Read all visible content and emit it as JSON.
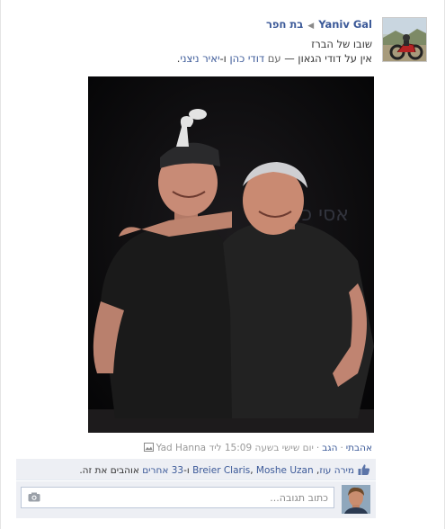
{
  "post": {
    "author": "Yaniv Gal",
    "target": "בת חפר",
    "message_line1": "שובו של הברז",
    "message_line2_prefix": "אין על דודי הגאון — ",
    "with_word": "עם",
    "tag1": "דודי כהן",
    "tag_and": " ו-",
    "tag2": "יאיר ניצני",
    "tag_end": "."
  },
  "meta": {
    "like_link": "אהבתי",
    "comment_link": "הגב",
    "timestamp": "יום שישי בשעה 15:09 ליד",
    "location": "Yad Hanna"
  },
  "likes": {
    "name1": "מירה עוז",
    "name2": "Breier Claris",
    "name3": "Moshe Uzan",
    "others_link": "33 אחרים",
    "suffix": " אוהבים את זה."
  },
  "comment": {
    "placeholder": "כתוב תגובה..."
  },
  "colors": {
    "link": "#3b5998",
    "likes_bg": "#edeff4",
    "meta_text": "#999999"
  },
  "icons": [
    "arrow-right-icon",
    "photo-icon",
    "thumbs-up-icon",
    "camera-icon"
  ]
}
